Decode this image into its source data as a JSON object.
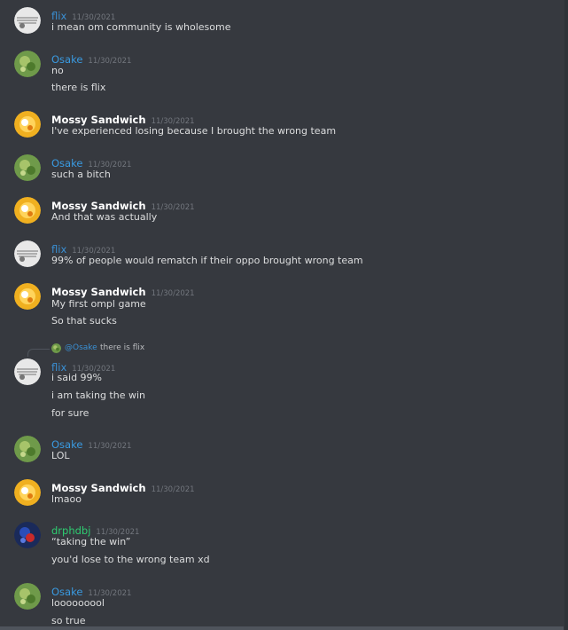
{
  "messages": [
    {
      "author": "flix",
      "timestamp": "11/30/2021",
      "lines": [
        "i mean om community is wholesome"
      ]
    },
    {
      "author": "Osake",
      "timestamp": "11/30/2021",
      "lines": [
        "no",
        "there is flix"
      ]
    },
    {
      "author": "Mossy Sandwich",
      "timestamp": "11/30/2021",
      "lines": [
        "I've experienced losing because I brought the wrong team"
      ]
    },
    {
      "author": "Osake",
      "timestamp": "11/30/2021",
      "lines": [
        "such a bitch"
      ]
    },
    {
      "author": "Mossy Sandwich",
      "timestamp": "11/30/2021",
      "lines": [
        "And that was actually"
      ]
    },
    {
      "author": "flix",
      "timestamp": "11/30/2021",
      "lines": [
        "99% of people would rematch if their oppo brought wrong team"
      ]
    },
    {
      "author": "Mossy Sandwich",
      "timestamp": "11/30/2021",
      "lines": [
        "My first ompl game",
        "So that sucks"
      ]
    },
    {
      "reply": {
        "mention": "@Osake",
        "text": "there is flix"
      },
      "author": "flix",
      "timestamp": "11/30/2021",
      "lines": [
        "i said 99%",
        "i am taking the win",
        "for sure"
      ]
    },
    {
      "author": "Osake",
      "timestamp": "11/30/2021",
      "lines": [
        "LOL"
      ]
    },
    {
      "author": "Mossy Sandwich",
      "timestamp": "11/30/2021",
      "lines": [
        "lmaoo"
      ]
    },
    {
      "author": "drphdbj",
      "timestamp": "11/30/2021",
      "lines": [
        "“taking the win”",
        "you'd lose to the wrong team xd"
      ]
    },
    {
      "author": "Osake",
      "timestamp": "11/30/2021",
      "lines": [
        "looooooool",
        "so true"
      ]
    }
  ],
  "colors": {
    "background": "#36393f",
    "flix": "#3a8fd3",
    "osake": "#3a9ae0",
    "mossy": "#ffffff",
    "drphdbj": "#2ecc71",
    "timestamp": "#72767d",
    "message_text": "#dcddde"
  }
}
